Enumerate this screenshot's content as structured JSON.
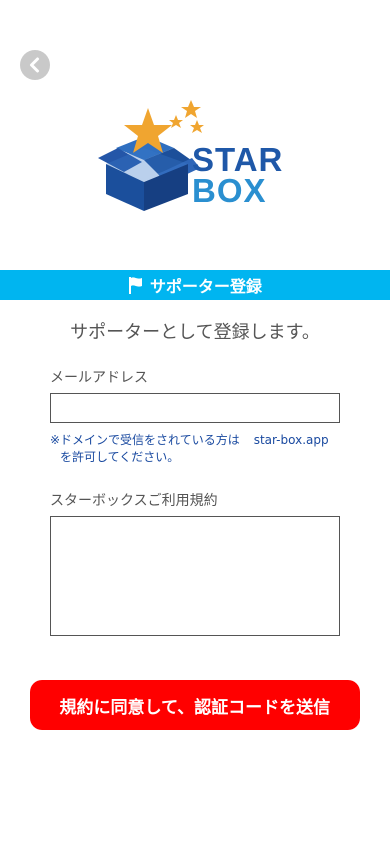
{
  "header": {
    "back_icon": "chevron-left-icon",
    "logo_text_line1": "STAR",
    "logo_text_line2": "BOX"
  },
  "title_bar": {
    "icon": "flag-icon",
    "title": "サポーター登録",
    "color": "#00b5f0"
  },
  "main": {
    "lead": "サポーターとして登録します。",
    "email": {
      "label": "メールアドレス",
      "value": "",
      "placeholder": ""
    },
    "notice_line1": "※ドメインで受信をされている方は",
    "notice_domain": "star-box.app",
    "notice_line2": "を許可してください。",
    "terms": {
      "label": "スターボックスご利用規約",
      "content": ""
    },
    "submit_label": "規約に同意して、認証コードを送信",
    "submit_color": "#ff0000"
  }
}
